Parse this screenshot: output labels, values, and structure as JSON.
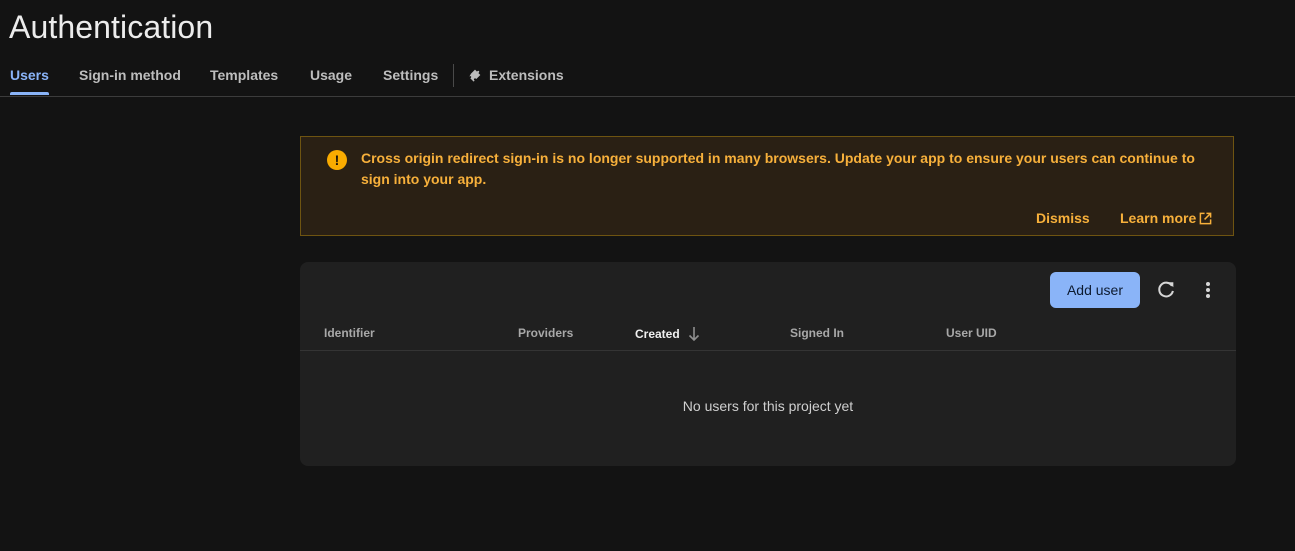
{
  "page": {
    "title": "Authentication"
  },
  "tabs": [
    {
      "label": "Users",
      "active": true
    },
    {
      "label": "Sign-in method"
    },
    {
      "label": "Templates"
    },
    {
      "label": "Usage"
    },
    {
      "label": "Settings"
    },
    {
      "label": "Extensions",
      "icon": "extension-icon"
    }
  ],
  "banner": {
    "icon": "warning-icon",
    "message": "Cross origin redirect sign-in is no longer supported in many browsers. Update your app to ensure your users can continue to sign into your app.",
    "dismiss_label": "Dismiss",
    "learn_more_label": "Learn more",
    "learn_more_icon": "open-in-new-icon"
  },
  "users_table": {
    "add_user_label": "Add user",
    "refresh_icon": "refresh-icon",
    "more_icon": "more-vert-icon",
    "columns": [
      "Identifier",
      "Providers",
      "Created",
      "Signed In",
      "User UID"
    ],
    "sorted_column": "Created",
    "sort_icon": "arrow-down-icon",
    "empty_message": "No users for this project yet"
  },
  "colors": {
    "accent": "#8ab4f8",
    "warning": "#f9ab00",
    "warning_text": "#f7b03b",
    "background": "#131313",
    "card": "#202020"
  }
}
